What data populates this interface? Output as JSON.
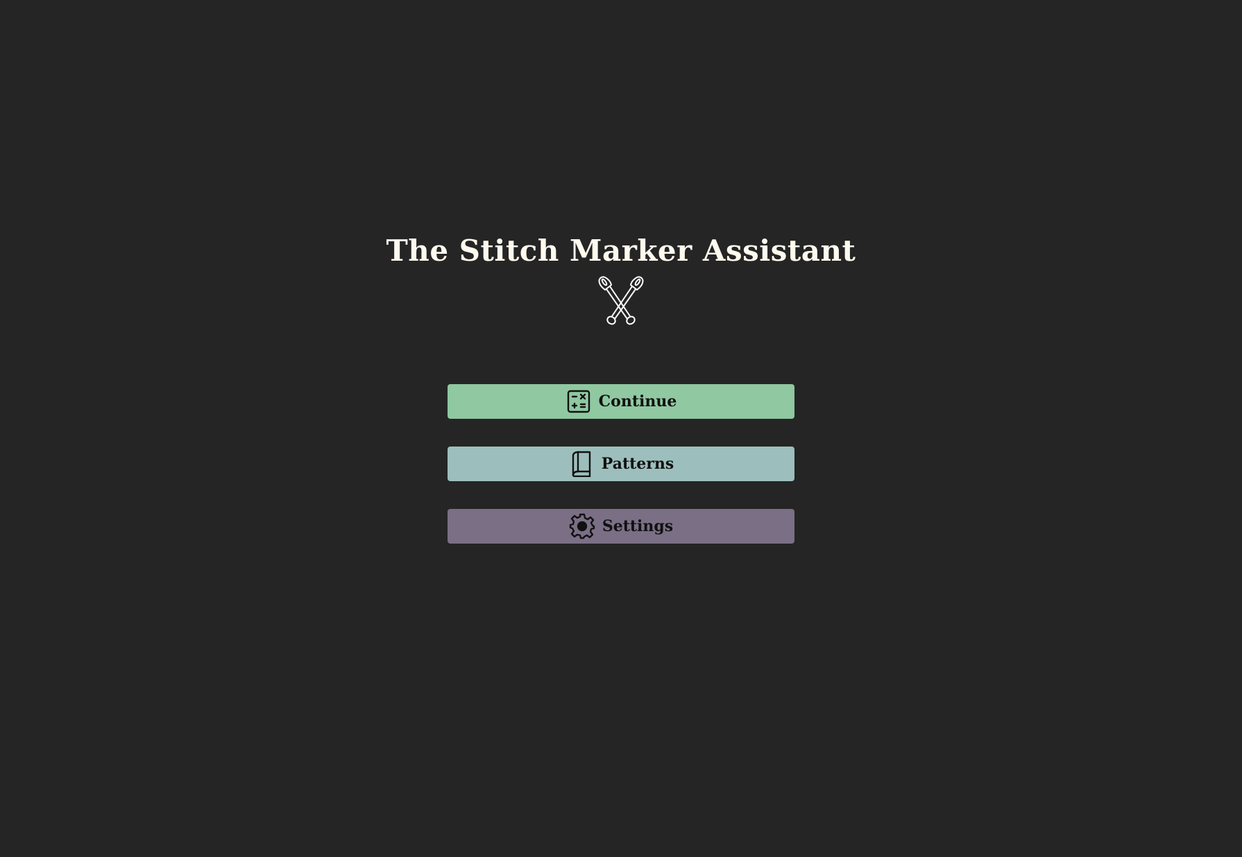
{
  "app": {
    "title": "The Stitch Marker Assistant",
    "logo_icon": "crossed-safety-pins-icon"
  },
  "menu": {
    "continue": {
      "label": "Continue",
      "icon": "calculator-icon",
      "color": "#8fc8a1"
    },
    "patterns": {
      "label": "Patterns",
      "icon": "book-icon",
      "color": "#9cbfbd"
    },
    "settings": {
      "label": "Settings",
      "icon": "gear-icon",
      "color": "#7b6f86"
    }
  },
  "colors": {
    "background": "#252525",
    "title_text": "#fffaee",
    "button_text": "#111111"
  }
}
